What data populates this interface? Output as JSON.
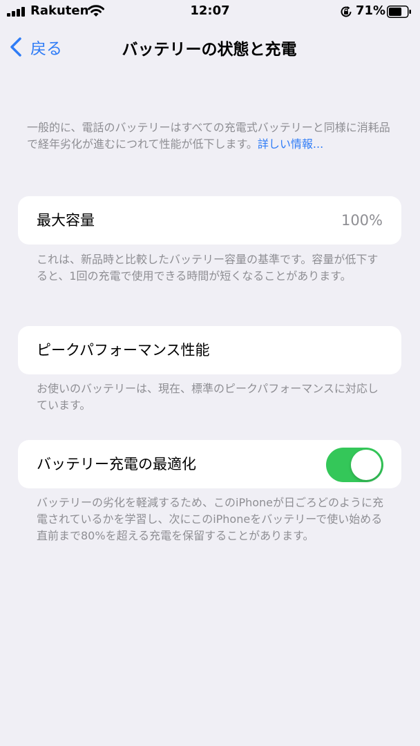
{
  "status_bar": {
    "carrier": "Rakuten",
    "time": "12:07",
    "battery_percent": "71%",
    "battery_level": 0.71,
    "icons": [
      "signal-icon",
      "wifi-icon",
      "rotation-lock-icon",
      "battery-icon"
    ]
  },
  "nav": {
    "back_label": "戻る",
    "title": "バッテリーの状態と充電",
    "accent_color": "#2f7cf6"
  },
  "intro": {
    "text": "一般的に、電話のバッテリーはすべての充電式バッテリーと同様に消耗品で経年劣化が進むにつれて性能が低下します。",
    "link": "詳しい情報..."
  },
  "max_capacity": {
    "label": "最大容量",
    "value": "100%",
    "footer": "これは、新品時と比較したバッテリー容量の基準です。容量が低下すると、1回の充電で使用できる時間が短くなることがあります。"
  },
  "peak_performance": {
    "label": "ピークパフォーマンス性能",
    "footer": "お使いのバッテリーは、現在、標準のピークパフォーマンスに対応しています。"
  },
  "optimized_charging": {
    "label": "バッテリー充電の最適化",
    "enabled": true,
    "toggle_color": "#34c759",
    "footer": "バッテリーの劣化を軽減するため、このiPhoneが日ごろどのように充電されているかを学習し、次にこのiPhoneをバッテリーで使い始める直前まで80%を超える充電を保留することがあります。"
  }
}
